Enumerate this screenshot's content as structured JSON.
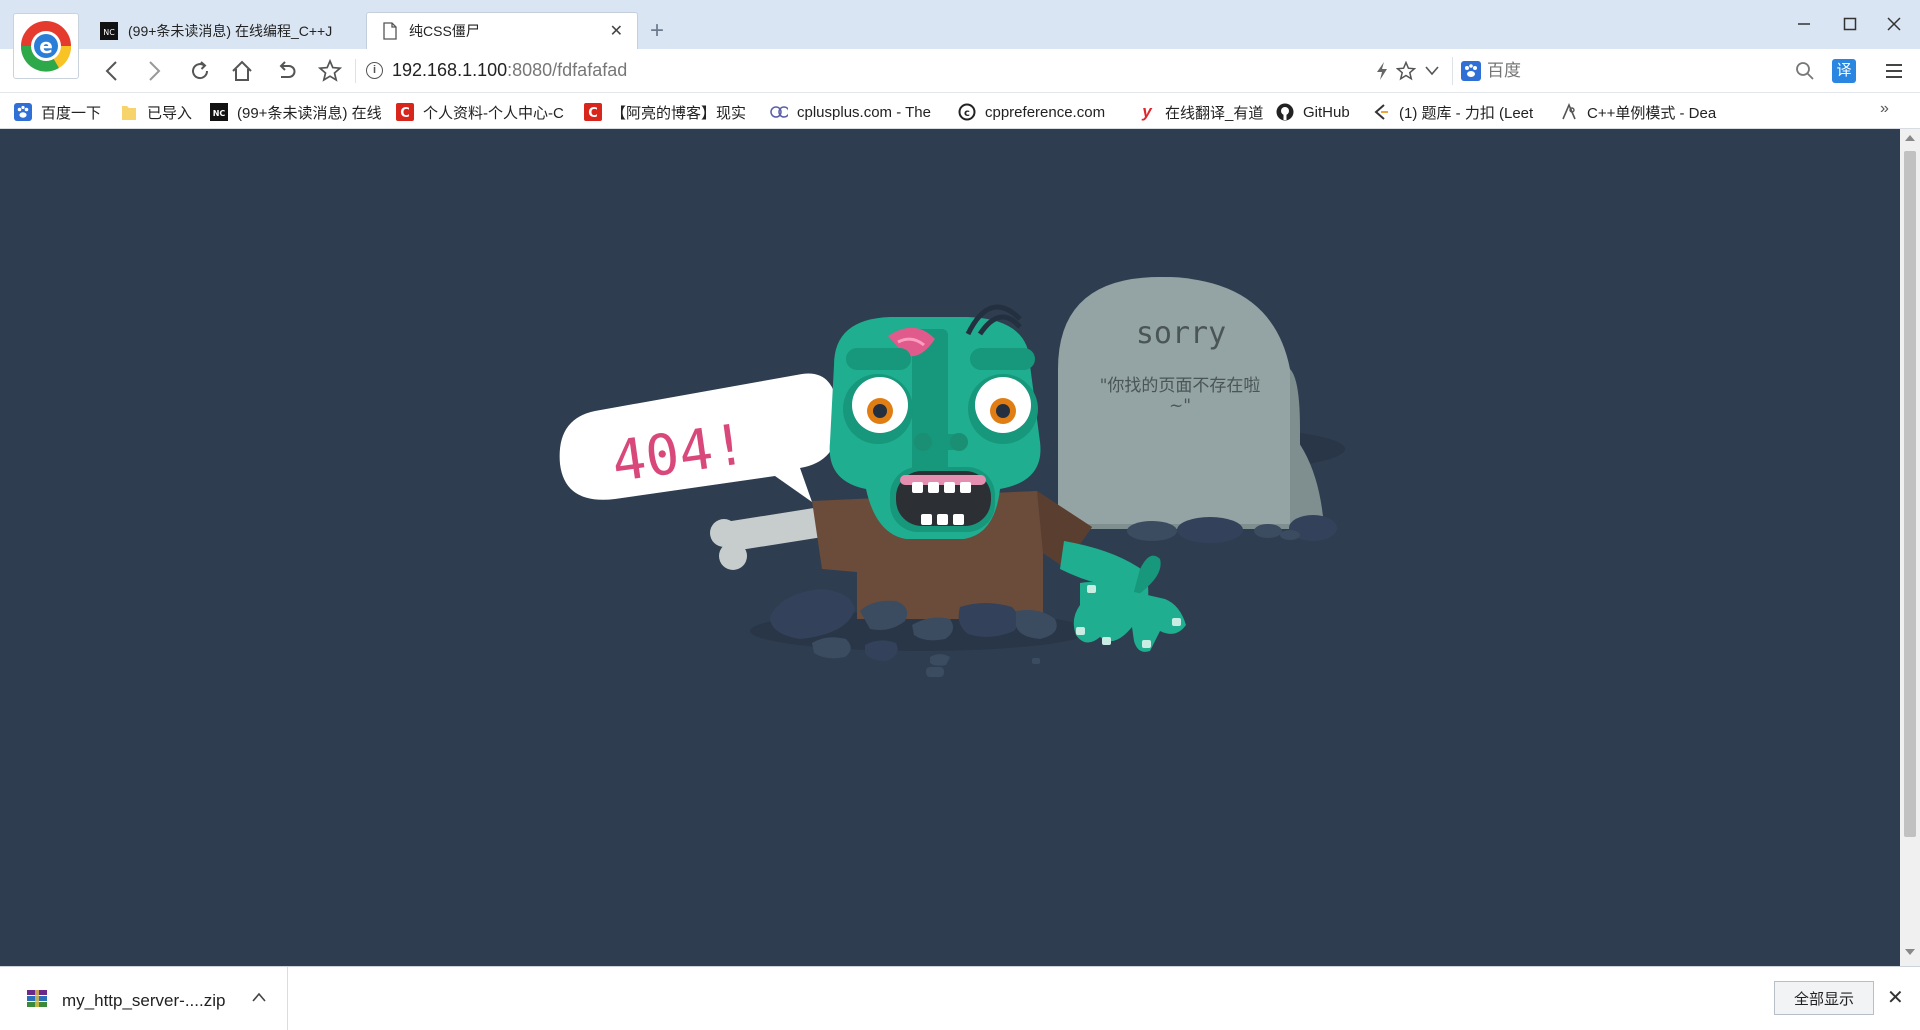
{
  "tabs": [
    {
      "title": "(99+条未读消息) 在线编程_C++J",
      "active": false
    },
    {
      "title": "纯CSS僵尸",
      "active": true
    }
  ],
  "toolbar": {
    "url_host": "192.168.1.100",
    "url_rest": ":8080/fdfafafad",
    "search_placeholder": "百度",
    "translate_label": "译"
  },
  "bookmarks": [
    {
      "label": "百度一下",
      "icon": "baidu-paw-icon"
    },
    {
      "label": "已导入",
      "icon": "folder-icon"
    },
    {
      "label": "(99+条未读消息) 在线",
      "icon": "nowcoder-icon"
    },
    {
      "label": "个人资料-个人中心-C",
      "icon": "csdn-icon"
    },
    {
      "label": "【阿亮的博客】现实",
      "icon": "csdn-icon"
    },
    {
      "label": "cplusplus.com - The",
      "icon": "cplusplus-icon"
    },
    {
      "label": "cppreference.com",
      "icon": "cppreference-icon"
    },
    {
      "label": "在线翻译_有道",
      "icon": "youdao-icon"
    },
    {
      "label": "GitHub",
      "icon": "github-icon"
    },
    {
      "label": "(1) 题库 - 力扣 (Leet",
      "icon": "leetcode-icon"
    },
    {
      "label": "C++单例模式 - Dea",
      "icon": "cnblogs-icon"
    }
  ],
  "page": {
    "bubble_text": "404!",
    "tomb_title": "sorry",
    "tomb_line1": "\"你找的页面不存在啦",
    "tomb_line2": "~\""
  },
  "downloads": {
    "file_name": "my_http_server-....zip",
    "show_all_label": "全部显示"
  },
  "colors": {
    "page_bg": "#2e3d50",
    "zombie_green": "#1fae8f",
    "bubble_text": "#d9487a",
    "tomb": "#94a3a3"
  }
}
